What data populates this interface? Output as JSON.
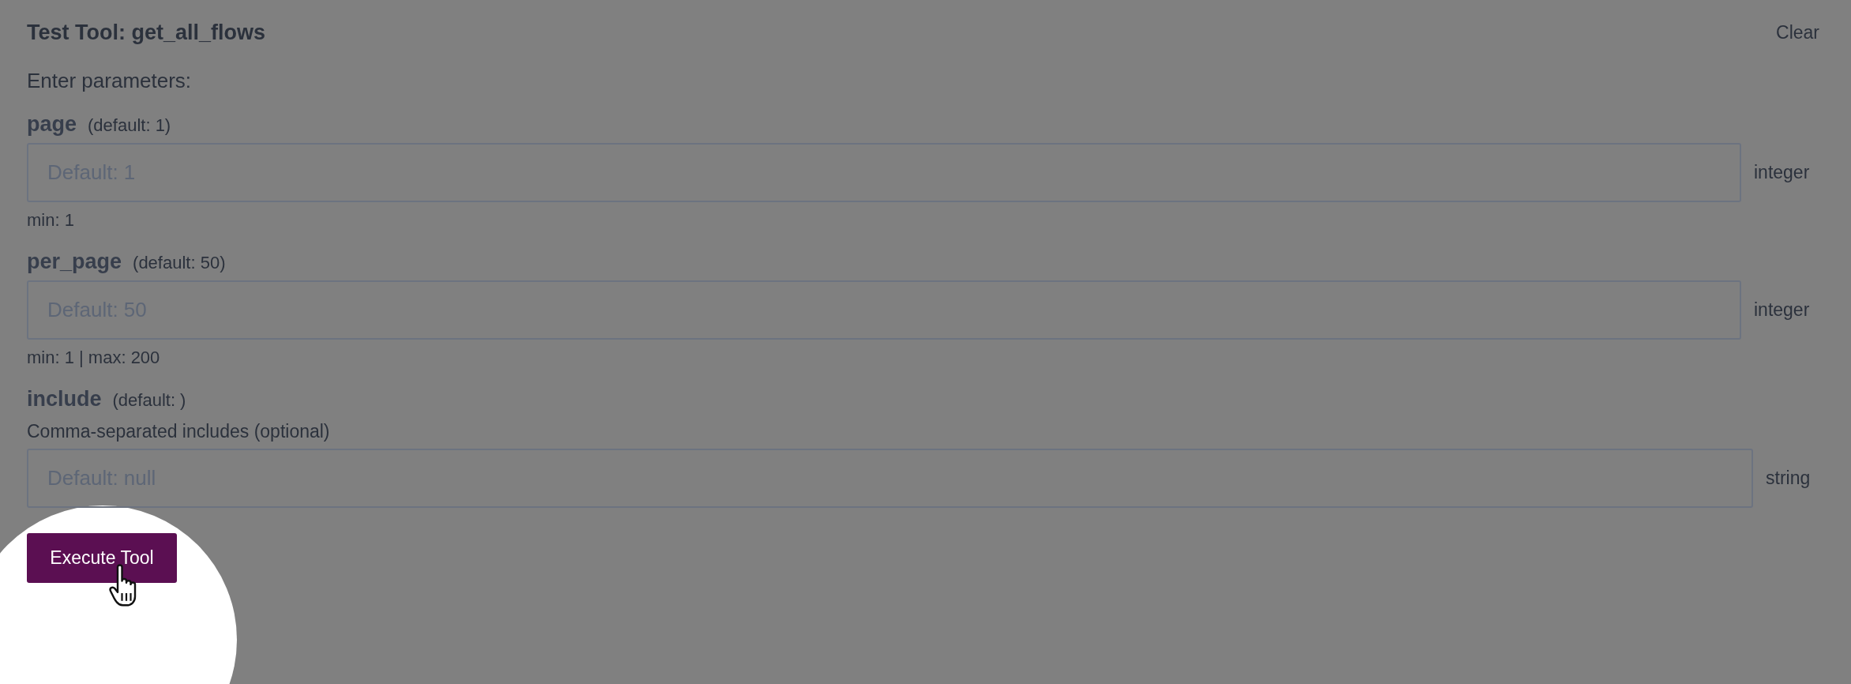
{
  "title": "Test Tool: get_all_flows",
  "clear_button": "Clear",
  "intro": "Enter parameters:",
  "params": [
    {
      "name": "page",
      "default_note": "(default: 1)",
      "placeholder": "Default: 1",
      "type": "integer",
      "hint": "min: 1"
    },
    {
      "name": "per_page",
      "default_note": "(default: 50)",
      "placeholder": "Default: 50",
      "type": "integer",
      "hint": "min: 1 | max: 200"
    },
    {
      "name": "include",
      "default_note": "(default: )",
      "description": "Comma-separated includes (optional)",
      "placeholder": "Default: null",
      "type": "string"
    }
  ],
  "execute_button": "Execute Tool"
}
